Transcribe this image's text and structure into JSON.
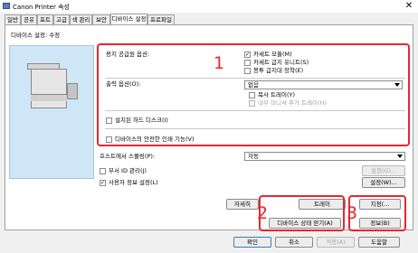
{
  "window": {
    "title": "Canon Printer 속성",
    "close_glyph": "✕"
  },
  "tabs": [
    {
      "label": "일반"
    },
    {
      "label": "공유"
    },
    {
      "label": "포트"
    },
    {
      "label": "고급"
    },
    {
      "label": "색 관리"
    },
    {
      "label": "보안"
    },
    {
      "label": "디바이스 설정"
    },
    {
      "label": "프로파일"
    }
  ],
  "panel": {
    "heading": "디바이스 설정: 수정",
    "paper_source": {
      "label": "용지 공급원 옵션:",
      "options": [
        {
          "label": "카세트 모듈(M)",
          "checked": true,
          "check": "✓"
        },
        {
          "label": "카세트 급지 유니트(S)",
          "checked": false
        },
        {
          "label": "봉투 급지대 장착(E)",
          "checked": false
        }
      ]
    },
    "output": {
      "label": "출력 옵션(O):",
      "value": "없음",
      "options": [
        {
          "label": "복사 트레이(Y)",
          "checked": false,
          "disabled": false
        },
        {
          "label": "내부 미니셔 추가 트레이(H)",
          "checked": false,
          "disabled": true
        }
      ]
    },
    "hard_disk": {
      "label": "설치된 하드 디스크(I)"
    },
    "secure_erase": {
      "label": "디바이스의 안전한 인쇄 기능(V)"
    },
    "spooling": {
      "label": "호스트에서 스풀링(P):",
      "value": "자동"
    },
    "dept_id": {
      "label": "부서 ID 관리(J)",
      "settings": "설정(G)..."
    },
    "user_info": {
      "label": "사용자 정보 설정(L)",
      "check": "✓",
      "settings": "설정(W)..."
    },
    "buttons": {
      "details": "자세히",
      "tray": "트레이",
      "device_status": "디바이스 상태 얻기(A)",
      "specify": "지정(...",
      "info": "정보(B)"
    }
  },
  "footer": {
    "ok": "확인",
    "cancel": "취소",
    "apply": "적용(A)",
    "help": "도움말"
  },
  "annotations": [
    "1",
    "2",
    "3"
  ],
  "colors": {
    "annotation_red": "#e8262f",
    "preview_bg": "#cfe6f6"
  }
}
